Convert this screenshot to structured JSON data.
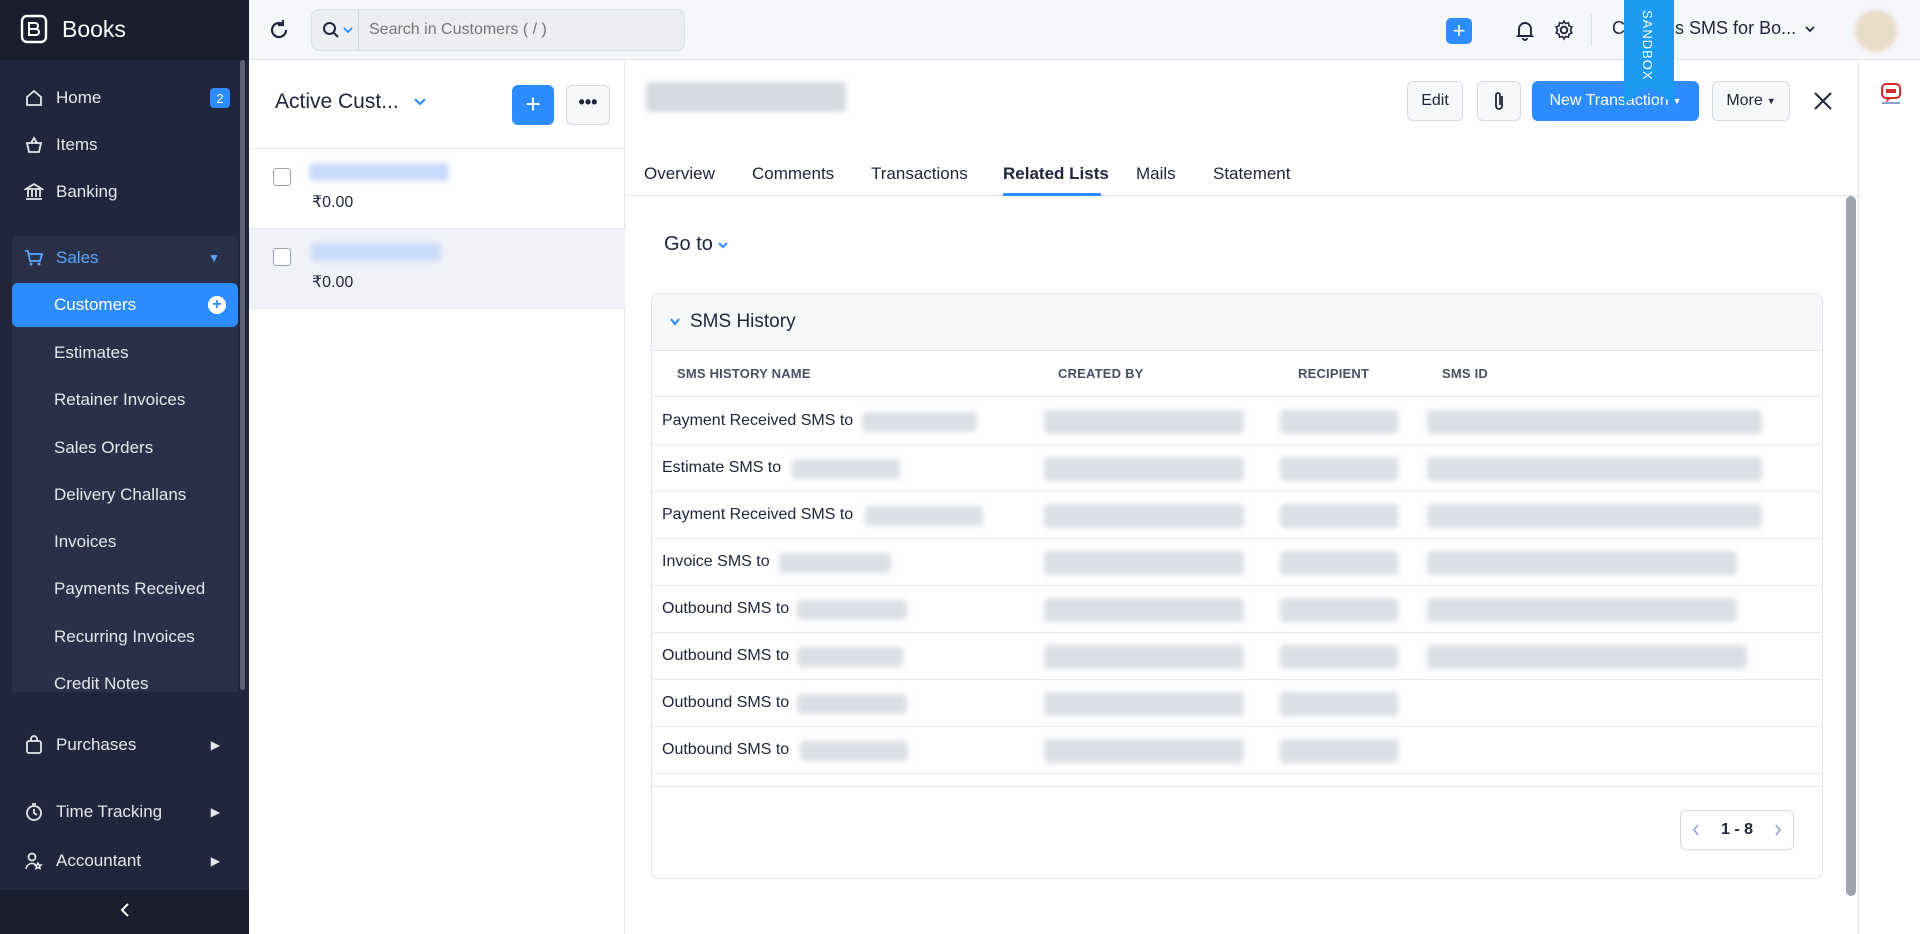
{
  "brand": {
    "name": "Books"
  },
  "sidebar": {
    "home": {
      "label": "Home",
      "badge": "2"
    },
    "items": {
      "label": "Items"
    },
    "banking": {
      "label": "Banking"
    },
    "sales": {
      "label": "Sales"
    },
    "sub_items": [
      "Customers",
      "Estimates",
      "Retainer Invoices",
      "Sales Orders",
      "Delivery Challans",
      "Invoices",
      "Payments Received",
      "Recurring Invoices",
      "Credit Notes"
    ],
    "purchases": {
      "label": "Purchases"
    },
    "time_tracking": {
      "label": "Time Tracking"
    },
    "accountant": {
      "label": "Accountant"
    }
  },
  "topbar": {
    "search_placeholder": "Search in Customers ( / )",
    "sandbox_label": "SANDBOX",
    "org_name": "Cequens SMS for Bo..."
  },
  "list": {
    "title": "Active Cust...",
    "rows": [
      {
        "amount": "₹0.00"
      },
      {
        "amount": "₹0.00"
      }
    ]
  },
  "detail": {
    "edit_label": "Edit",
    "new_transaction_label": "New Transaction",
    "more_label": "More",
    "tabs": [
      "Overview",
      "Comments",
      "Transactions",
      "Related Lists",
      "Mails",
      "Statement"
    ],
    "active_tab": "Related Lists",
    "goto_label": "Go to",
    "section_title": "SMS History",
    "columns": [
      "SMS HISTORY NAME",
      "CREATED BY",
      "RECIPIENT",
      "SMS ID"
    ],
    "rows": [
      "Payment Received SMS to",
      "Estimate SMS to",
      "Payment Received SMS to",
      "Invoice SMS to",
      "Outbound SMS to",
      "Outbound SMS to",
      "Outbound SMS to",
      "Outbound SMS to"
    ],
    "pagination": "1 - 8"
  },
  "colors": {
    "accent": "#2d8cff",
    "sidebar_bg": "#21263c",
    "sandbox": "#1d9bf0"
  }
}
